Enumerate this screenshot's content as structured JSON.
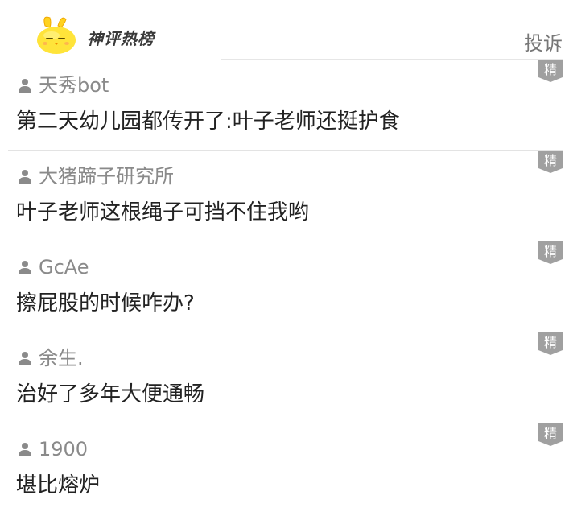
{
  "header": {
    "brand": "神评热榜",
    "report_label": "投诉",
    "mascot_icon": "yellow-chick-mascot-icon"
  },
  "badge_label": "精",
  "colors": {
    "author_text": "#8a8a8a",
    "comment_text": "#222222",
    "badge_bg": "#a0a0a0",
    "divider": "#e3e3e3",
    "mascot": "#ffe43a"
  },
  "comments": [
    {
      "author": "天秀bot",
      "text": "第二天幼儿园都传开了:叶子老师还挺护食",
      "badge": "精"
    },
    {
      "author": "大猪蹄子研究所",
      "text": "叶子老师这根绳子可挡不住我哟",
      "badge": "精"
    },
    {
      "author": "GcAe",
      "text": "擦屁股的时候咋办?",
      "badge": "精"
    },
    {
      "author": "余生.",
      "text": "治好了多年大便通畅",
      "badge": "精"
    },
    {
      "author": "1900",
      "text": "堪比熔炉",
      "badge": "精"
    }
  ]
}
